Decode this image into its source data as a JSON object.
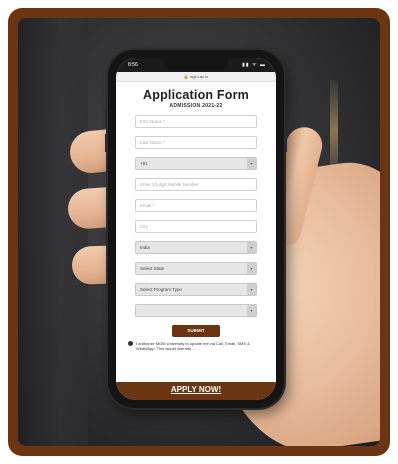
{
  "phone": {
    "status_time": "8:56",
    "status_icons": "▮▮ ᯤ ▬",
    "url": "🔒 mgm.ac.in"
  },
  "form": {
    "title": "Application Form",
    "subtitle": "ADMISSION 2021-22",
    "fields": [
      {
        "placeholder": "First Name *",
        "type": "text"
      },
      {
        "placeholder": "Last Name *",
        "type": "text"
      },
      {
        "placeholder": "+91",
        "type": "select"
      },
      {
        "placeholder": "Enter 10-digit Mobile Number",
        "type": "text"
      },
      {
        "placeholder": "Email *",
        "type": "text"
      },
      {
        "placeholder": "City",
        "type": "text"
      },
      {
        "placeholder": "India",
        "type": "select"
      },
      {
        "placeholder": "Select State",
        "type": "select"
      },
      {
        "placeholder": "Select Program Type",
        "type": "select"
      },
      {
        "placeholder": "",
        "type": "select"
      }
    ],
    "submit_label": "SUBMIT",
    "consent_text": "I authorize MGM University to update me via Call, Email, SMS & WhatsApp. This would override..."
  },
  "cta": {
    "apply_label": "APPLY NOW!"
  },
  "colors": {
    "brand_brown": "#6b3513",
    "background_dark": "#2b2b2d"
  }
}
